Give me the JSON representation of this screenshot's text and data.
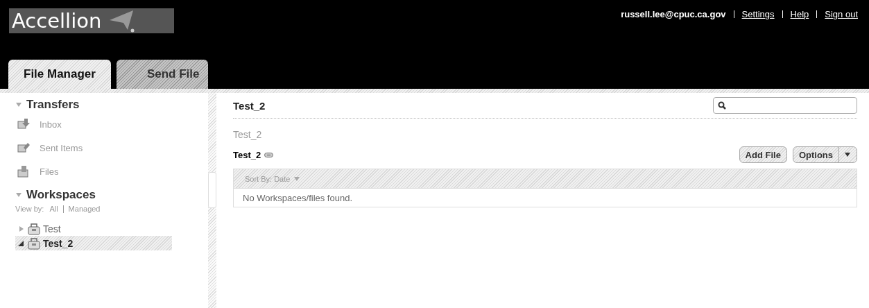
{
  "header": {
    "logo": "Accellion",
    "user": "russell.lee@cpuc.ca.gov",
    "links": [
      "Settings",
      "Help",
      "Sign out"
    ]
  },
  "tabs": [
    {
      "label": "File Manager",
      "selected": true
    },
    {
      "label": "Send File",
      "selected": false
    }
  ],
  "sidebar": {
    "transfers": {
      "title": "Transfers",
      "expanded": true,
      "items": [
        {
          "label": "Inbox",
          "kind": "inbox"
        },
        {
          "label": "Sent Items",
          "kind": "sent"
        },
        {
          "label": "Files",
          "kind": "files"
        }
      ]
    },
    "workspaces": {
      "title": "Workspaces",
      "expanded": true,
      "view_by": "View by:",
      "filters": [
        "All",
        "Managed"
      ],
      "tree": [
        {
          "label": "Test",
          "expanded": false,
          "selected": false
        },
        {
          "label": "Test_2",
          "expanded": true,
          "selected": true
        }
      ]
    }
  },
  "main": {
    "title": "Test_2",
    "breadcrumb": "Test_2",
    "workspace": "Test_2",
    "buttons": [
      "Add File",
      "Options"
    ],
    "sort": "Sort By: Date",
    "empty": "No Workspaces/files found."
  }
}
